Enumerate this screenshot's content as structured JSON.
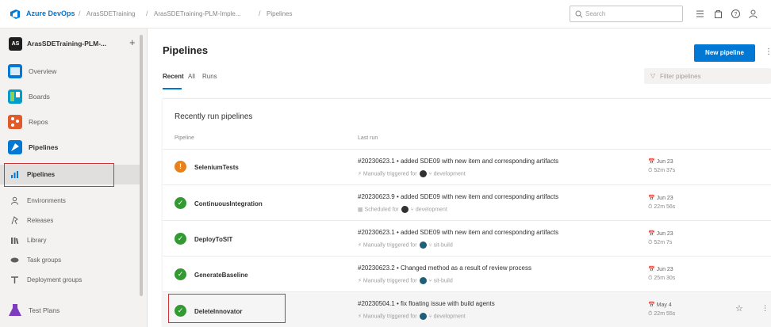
{
  "topbar": {
    "brand": "Azure DevOps",
    "org": "ArasSDETraining",
    "project": "ArasSDETraining-PLM-Imple...",
    "section": "Pipelines",
    "search_placeholder": "Search",
    "brand_color": "#0078d4",
    "icons": [
      "list-settings-icon",
      "shopping-bag-icon",
      "help-icon",
      "user-settings-icon"
    ]
  },
  "sidebar": {
    "project_avatar": "AS",
    "project_name": "ArasSDETraining-PLM-...",
    "add_symbol": "+",
    "items": [
      {
        "label": "Overview",
        "icon": "overview-icon",
        "color": "#0078d4"
      },
      {
        "label": "Boards",
        "icon": "boards-icon",
        "color": "#009ccc"
      },
      {
        "label": "Repos",
        "icon": "repos-icon",
        "color": "#e05a2b"
      },
      {
        "label": "Pipelines",
        "icon": "pipelines-icon",
        "color": "#0078d4"
      }
    ],
    "subitems": [
      {
        "label": "Pipelines",
        "icon": "pipelines-sub-icon"
      },
      {
        "label": "Environments",
        "icon": "environments-icon"
      },
      {
        "label": "Releases",
        "icon": "releases-icon"
      },
      {
        "label": "Library",
        "icon": "library-icon"
      },
      {
        "label": "Task groups",
        "icon": "task-groups-icon"
      },
      {
        "label": "Deployment groups",
        "icon": "deployment-groups-icon"
      }
    ],
    "bottom_item": {
      "label": "Test Plans",
      "icon": "test-plans-icon",
      "color": "#7f3bbf"
    }
  },
  "main": {
    "title": "Pipelines",
    "new_button": "New pipeline",
    "tabs": [
      "Recent",
      "All",
      "Runs"
    ],
    "filter_placeholder": "Filter pipelines",
    "section_title": "Recently run pipelines",
    "columns": [
      "Pipeline",
      "Last run"
    ]
  },
  "status_colors": {
    "warning": "#e8811a",
    "success": "#339933"
  },
  "pipelines": [
    {
      "name": "SeleniumTests",
      "status": "warning",
      "commit": "#20230623.1 • added SDE09 with new item and corresponding artifacts",
      "trigger_prefix": "Manually triggered for",
      "branch": "development",
      "date": "Jun 23",
      "duration": "52m 37s"
    },
    {
      "name": "ContinuousIntegration",
      "status": "success",
      "commit": "#20230623.9 • added SDE09 with new item and corresponding artifacts",
      "trigger_prefix": "Scheduled for",
      "branch": "development",
      "date": "Jun 23",
      "duration": "22m 56s"
    },
    {
      "name": "DeployToSIT",
      "status": "success",
      "commit": "#20230623.1 • added SDE09 with new item and corresponding artifacts",
      "trigger_prefix": "Manually triggered for",
      "branch": "sit-build",
      "date": "Jun 23",
      "duration": "52m 7s"
    },
    {
      "name": "GenerateBaseline",
      "status": "success",
      "commit": "#20230623.2 • Changed method as a result of review process",
      "trigger_prefix": "Manually triggered for",
      "branch": "sit-build",
      "date": "Jun 23",
      "duration": "25m 30s"
    },
    {
      "name": "DeleteInnovator",
      "status": "success",
      "commit": "#20230504.1 • fix floating issue with build agents",
      "trigger_prefix": "Manually triggered for",
      "branch": "development",
      "date": "May 4",
      "duration": "22m 55s"
    }
  ]
}
